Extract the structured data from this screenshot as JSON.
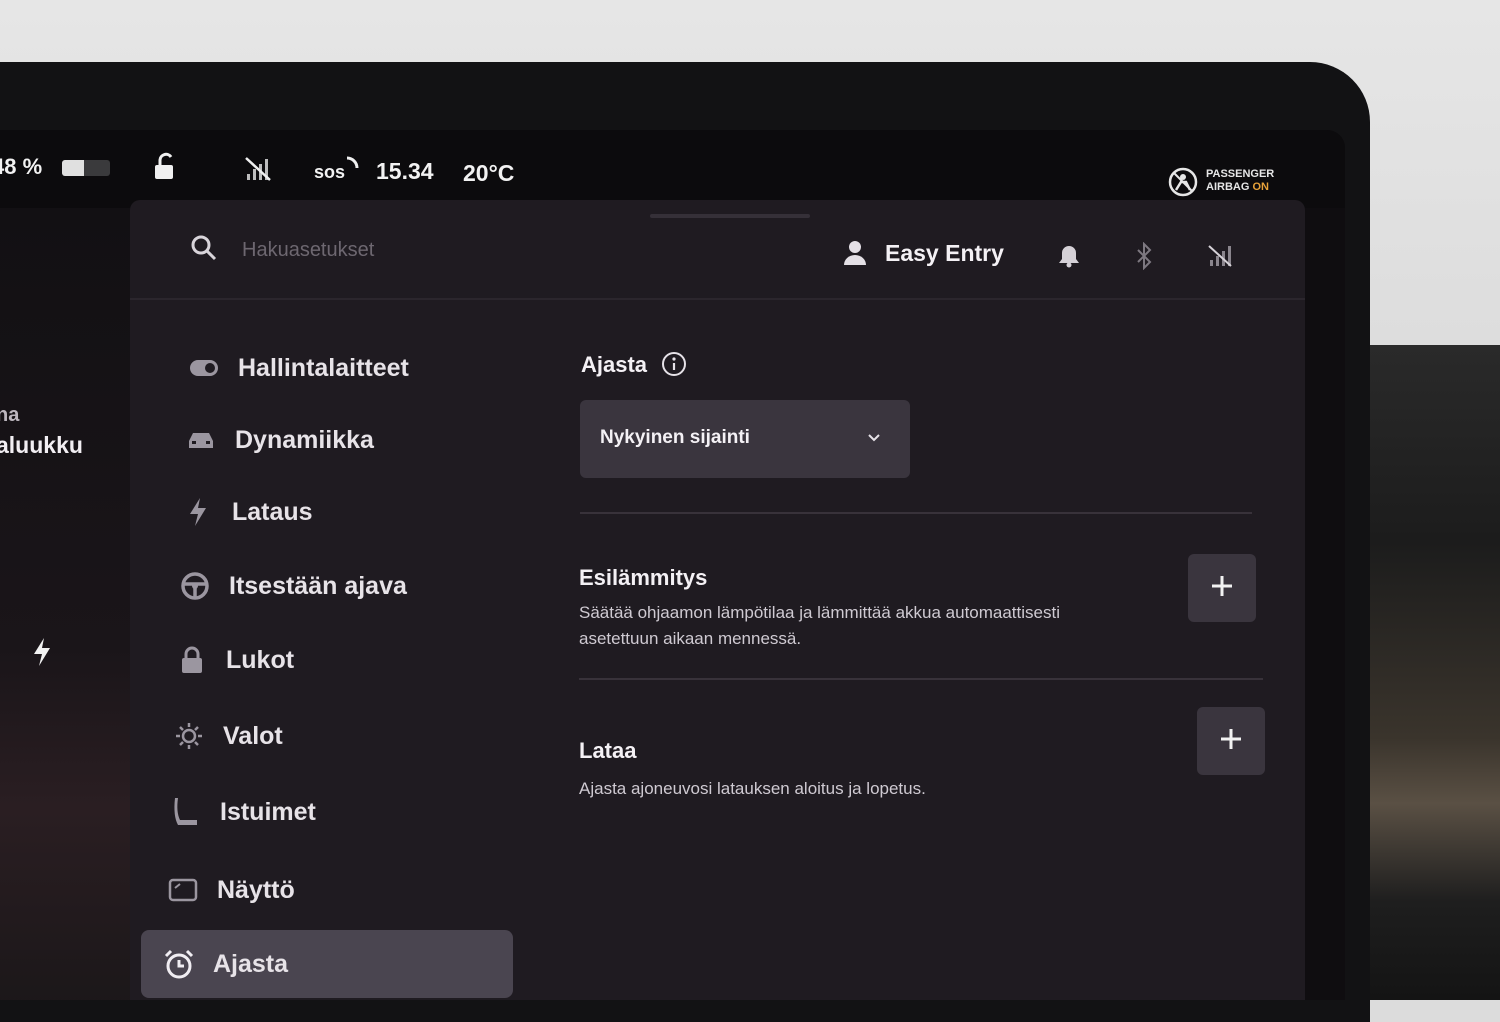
{
  "status_bar": {
    "battery_percent": "48 %",
    "clock": "15.34",
    "temperature": "20°C",
    "sos_label": "sos",
    "airbag_line1": "PASSENGER",
    "airbag_line2": "AIRBAG",
    "airbag_state": "ON"
  },
  "left_strip": {
    "partial_label_1": "na",
    "partial_label_2": "aluukku"
  },
  "header": {
    "search_placeholder": "Hakuasetukset",
    "profile_name": "Easy Entry"
  },
  "sidebar": {
    "items": [
      {
        "label": "Hallintalaitteet",
        "icon": "toggle-icon"
      },
      {
        "label": "Dynamiikka",
        "icon": "car-icon"
      },
      {
        "label": "Lataus",
        "icon": "bolt-icon"
      },
      {
        "label": "Itsestään ajava",
        "icon": "steering-wheel-icon"
      },
      {
        "label": "Lukot",
        "icon": "lock-icon"
      },
      {
        "label": "Valot",
        "icon": "sun-icon"
      },
      {
        "label": "Istuimet",
        "icon": "seat-icon"
      },
      {
        "label": "Näyttö",
        "icon": "display-icon"
      },
      {
        "label": "Ajasta",
        "icon": "alarm-clock-icon",
        "active": true
      }
    ]
  },
  "main": {
    "schedule_title": "Ajasta",
    "location_select": "Nykyinen sijainti",
    "preheat": {
      "title": "Esilämmitys",
      "description_line1": "Säätää ohjaamon lämpötilaa ja lämmittää akkua automaattisesti",
      "description_line2": "asetettuun aikaan mennessä."
    },
    "charge": {
      "title": "Lataa",
      "description": "Ajasta ajoneuvosi latauksen aloitus ja lopetus."
    }
  },
  "colors": {
    "panel_bg": "#1f1b21",
    "active_item_bg": "#4a4550",
    "airbag_on": "#e8a23a"
  }
}
